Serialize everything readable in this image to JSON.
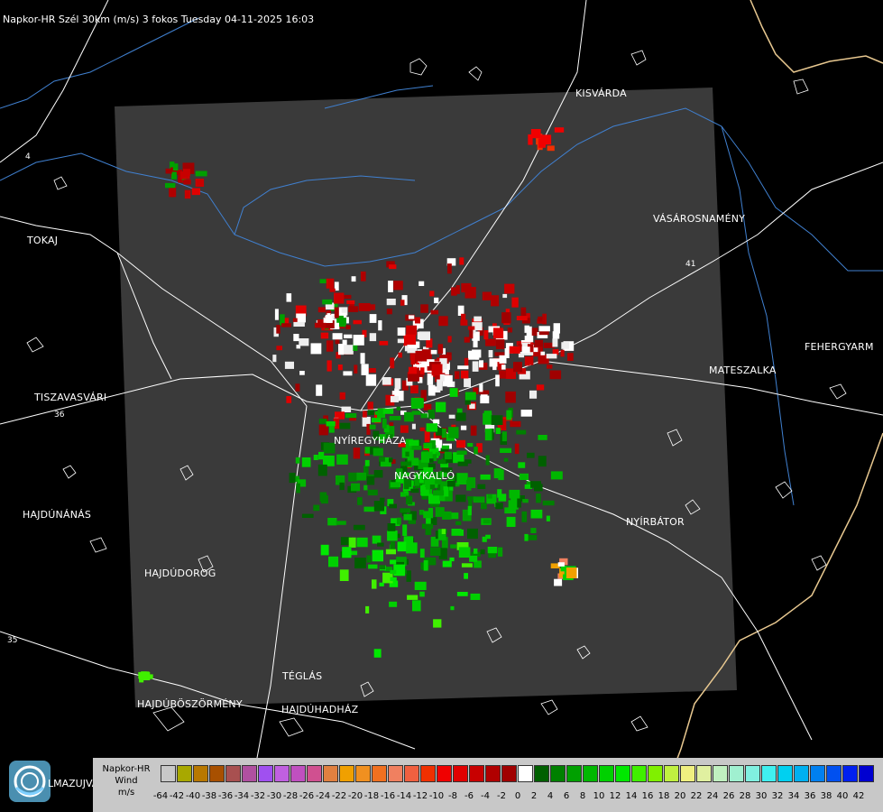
{
  "header": {
    "title": "Napkor-HR Szél 30km (m/s) 3 fokos Tuesday 04-11-2025 16:03"
  },
  "cities": [
    {
      "name": "KISVÁRDA"
    },
    {
      "name": "VÁSÁROSNAMÉNY"
    },
    {
      "name": "TOKAJ"
    },
    {
      "name": "FEHERGYARM"
    },
    {
      "name": "MATESZALKA"
    },
    {
      "name": "TISZAVASVÁRI"
    },
    {
      "name": "NYÍREGYHÁZA"
    },
    {
      "name": "NAGYKALLÓ"
    },
    {
      "name": "HAJDÚNÁNÁS"
    },
    {
      "name": "NYÍRBÁTOR"
    },
    {
      "name": "HAJDÚDOROG"
    },
    {
      "name": "TÉGLÁS"
    },
    {
      "name": "HAJDÚBÖSZÖRMÉNY"
    },
    {
      "name": "HAJDÚHADHÁZ"
    }
  ],
  "road_labels": [
    "4",
    "41",
    "36",
    "35"
  ],
  "legend": {
    "title_lines": [
      "Napkor-HR",
      "Wind",
      "m/s"
    ],
    "ticks": [
      "-64",
      "-42",
      "-40",
      "-38",
      "-36",
      "-34",
      "-32",
      "-30",
      "-28",
      "-26",
      "-24",
      "-22",
      "-20",
      "-18",
      "-16",
      "-14",
      "-12",
      "-10",
      "-8",
      "-6",
      "-4",
      "-2",
      "0",
      "2",
      "4",
      "6",
      "8",
      "10",
      "12",
      "14",
      "16",
      "18",
      "20",
      "22",
      "24",
      "26",
      "28",
      "30",
      "32",
      "34",
      "36",
      "38",
      "40",
      "42"
    ],
    "colors": [
      "#c8c8c8",
      "#a8a800",
      "#b87800",
      "#a85000",
      "#a85050",
      "#b050a0",
      "#a050f0",
      "#c060e0",
      "#c050c0",
      "#d05090",
      "#e08040",
      "#f0a000",
      "#f09020",
      "#f07020",
      "#f08060",
      "#f06040",
      "#f03000",
      "#f00000",
      "#e00000",
      "#c80000",
      "#b00000",
      "#a00000",
      "#ffffff",
      "#006000",
      "#008000",
      "#00a000",
      "#00b800",
      "#00d000",
      "#00e800",
      "#40f000",
      "#80f000",
      "#c0f040",
      "#f0f080",
      "#e0f0a0",
      "#c0f0c0",
      "#a0f0d0",
      "#80f0e0",
      "#40f0f0",
      "#00d0f0",
      "#00b0f0",
      "#0080f0",
      "#0050f0",
      "#0020f0",
      "#0000d0"
    ],
    "logo_text": "LMAZUJVAR"
  }
}
